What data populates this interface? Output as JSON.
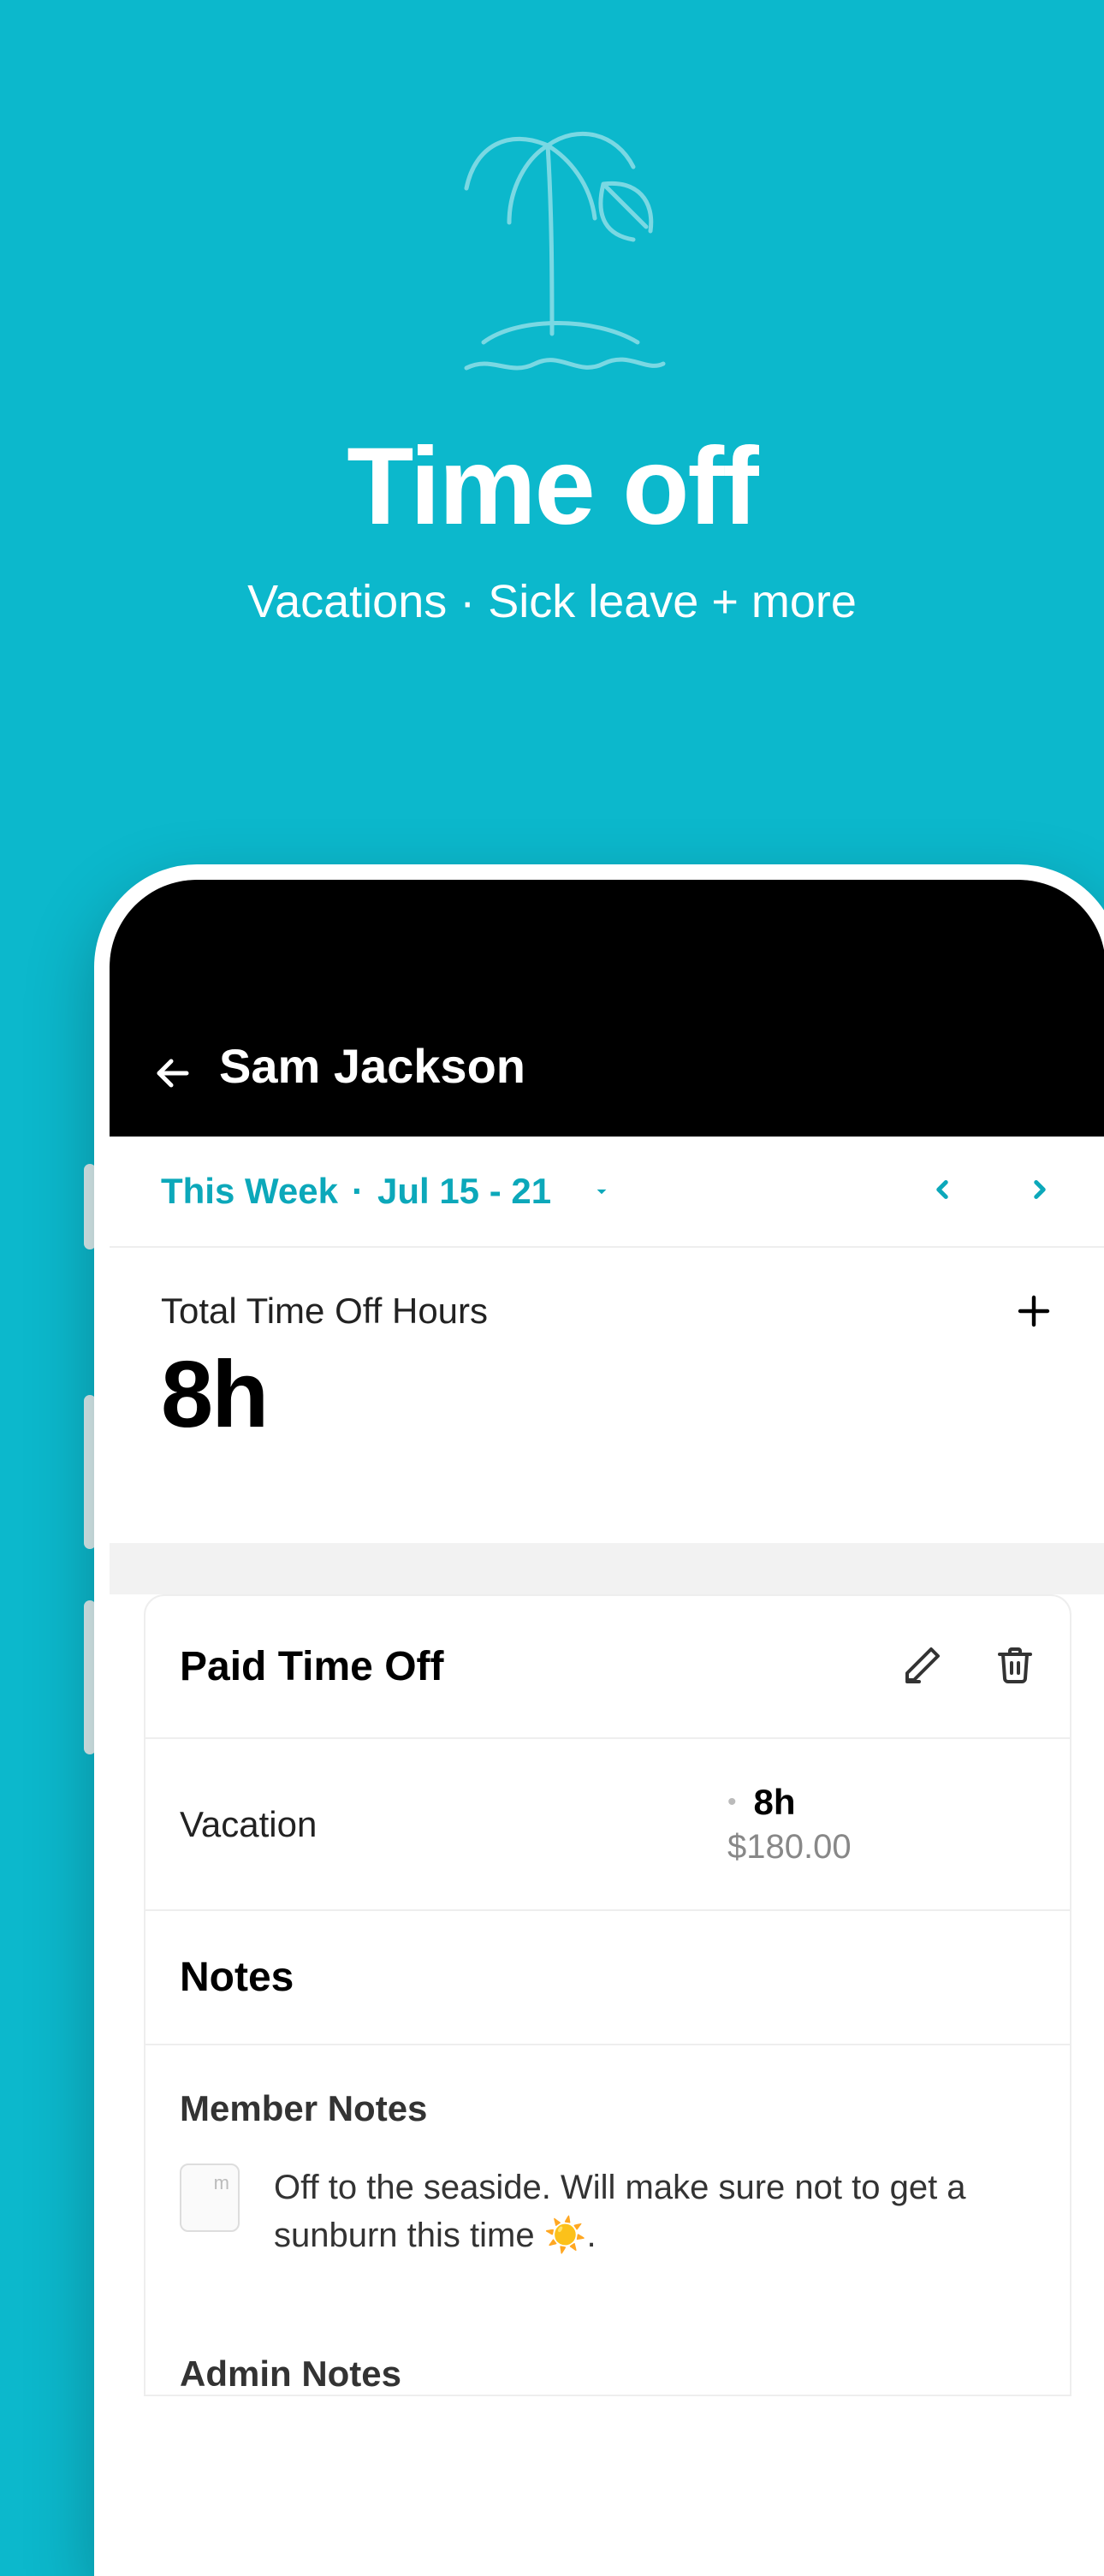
{
  "hero": {
    "title": "Time off",
    "subtitle": "Vacations · Sick leave + more"
  },
  "header": {
    "user_name": "Sam Jackson"
  },
  "date_picker": {
    "label": "This Week",
    "range": "Jul 15 - 21"
  },
  "summary": {
    "label": "Total Time Off Hours",
    "value": "8h"
  },
  "pto_card": {
    "title": "Paid Time Off",
    "entry": {
      "type": "Vacation",
      "hours": "8h",
      "amount": "$180.00"
    },
    "notes_heading": "Notes",
    "member_notes_heading": "Member Notes",
    "member_note": "Off to the seaside. Will make sure not to get a sunburn this time ☀️.",
    "admin_notes_heading": "Admin Notes"
  }
}
